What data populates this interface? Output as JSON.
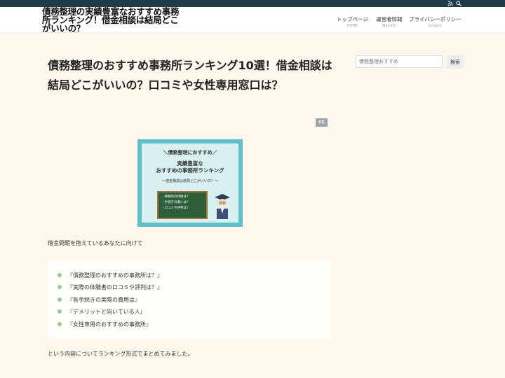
{
  "site": {
    "title": "債務整理の実績豊富なおすすめ事務所ランキング！借金相談は結局どこがいいの？"
  },
  "topbar": {
    "icons": [
      "rss-icon",
      "search-icon"
    ]
  },
  "nav": [
    {
      "label": "トップページ",
      "sub": "HOME"
    },
    {
      "label": "運営者情報",
      "sub": "MaCoTo"
    },
    {
      "label": "プライバシーポリシー",
      "sub": "privacy"
    }
  ],
  "search": {
    "placeholder": "債務整理おすすめ",
    "button": "検索"
  },
  "article": {
    "title": "債務整理のおすすめ事務所ランキング10選！借金相談は結局どこがいいの？口コミや女性専用窓口は？",
    "pr": "PR",
    "hero": {
      "line1": "＼債務整理におすすめ／",
      "line2": "実績豊富な",
      "line3": "おすすめの事務所ランキング",
      "line4": "〜借金相談は結局どこがいいの？〜",
      "board": [
        "・事務所の特徴は？",
        "・手続きの違いは？",
        "・口コミや評判は？"
      ],
      "colors": {
        "frame": "#5fbfc6",
        "board": "#2e5d3a"
      }
    },
    "intro": "借金問題を抱えているあなたに向けて",
    "items": [
      "『債務整理のおすすめの事務所は？』",
      "『実際の体験者の口コミや評判は？』",
      "『各手続きの実際の費用は』",
      "『デメリットと向いている人』",
      "『女性専用のおすすめの事務所』"
    ],
    "outro": "という内容についてランキング形式でまとめてみました。"
  }
}
